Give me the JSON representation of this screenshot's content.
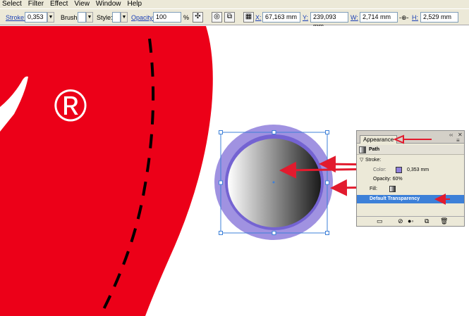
{
  "menu": [
    "Select",
    "Filter",
    "Effect",
    "View",
    "Window",
    "Help"
  ],
  "control": {
    "stroke_label": "Stroke:",
    "stroke_value": "0,353",
    "brush_label": "Brush:",
    "style_label": "Style:",
    "opacity_label": "Opacity:",
    "opacity_value": "100",
    "percent": "%",
    "x_label": "X:",
    "x_value": "67,163 mm",
    "y_label": "Y:",
    "y_value": "239,093 mm",
    "w_label": "W:",
    "w_value": "2,714 mm",
    "h_label": "H:",
    "h_value": "2,529 mm"
  },
  "canvas": {
    "registered_mark": "®"
  },
  "appearance": {
    "tab": "Appearance",
    "object": "Path",
    "stroke_label": "Stroke:",
    "color_label": "Color:",
    "stroke_weight": "0,353 mm",
    "opacity_label": "Opacity: 60%",
    "fill_label": "Fill:",
    "default_transparency": "Default Transparency"
  },
  "colors": {
    "red_shape": "#ec0018",
    "ring": "#8f7fdc",
    "annotation_arrow": "#e21b2e",
    "selection": "#3d80d8"
  }
}
